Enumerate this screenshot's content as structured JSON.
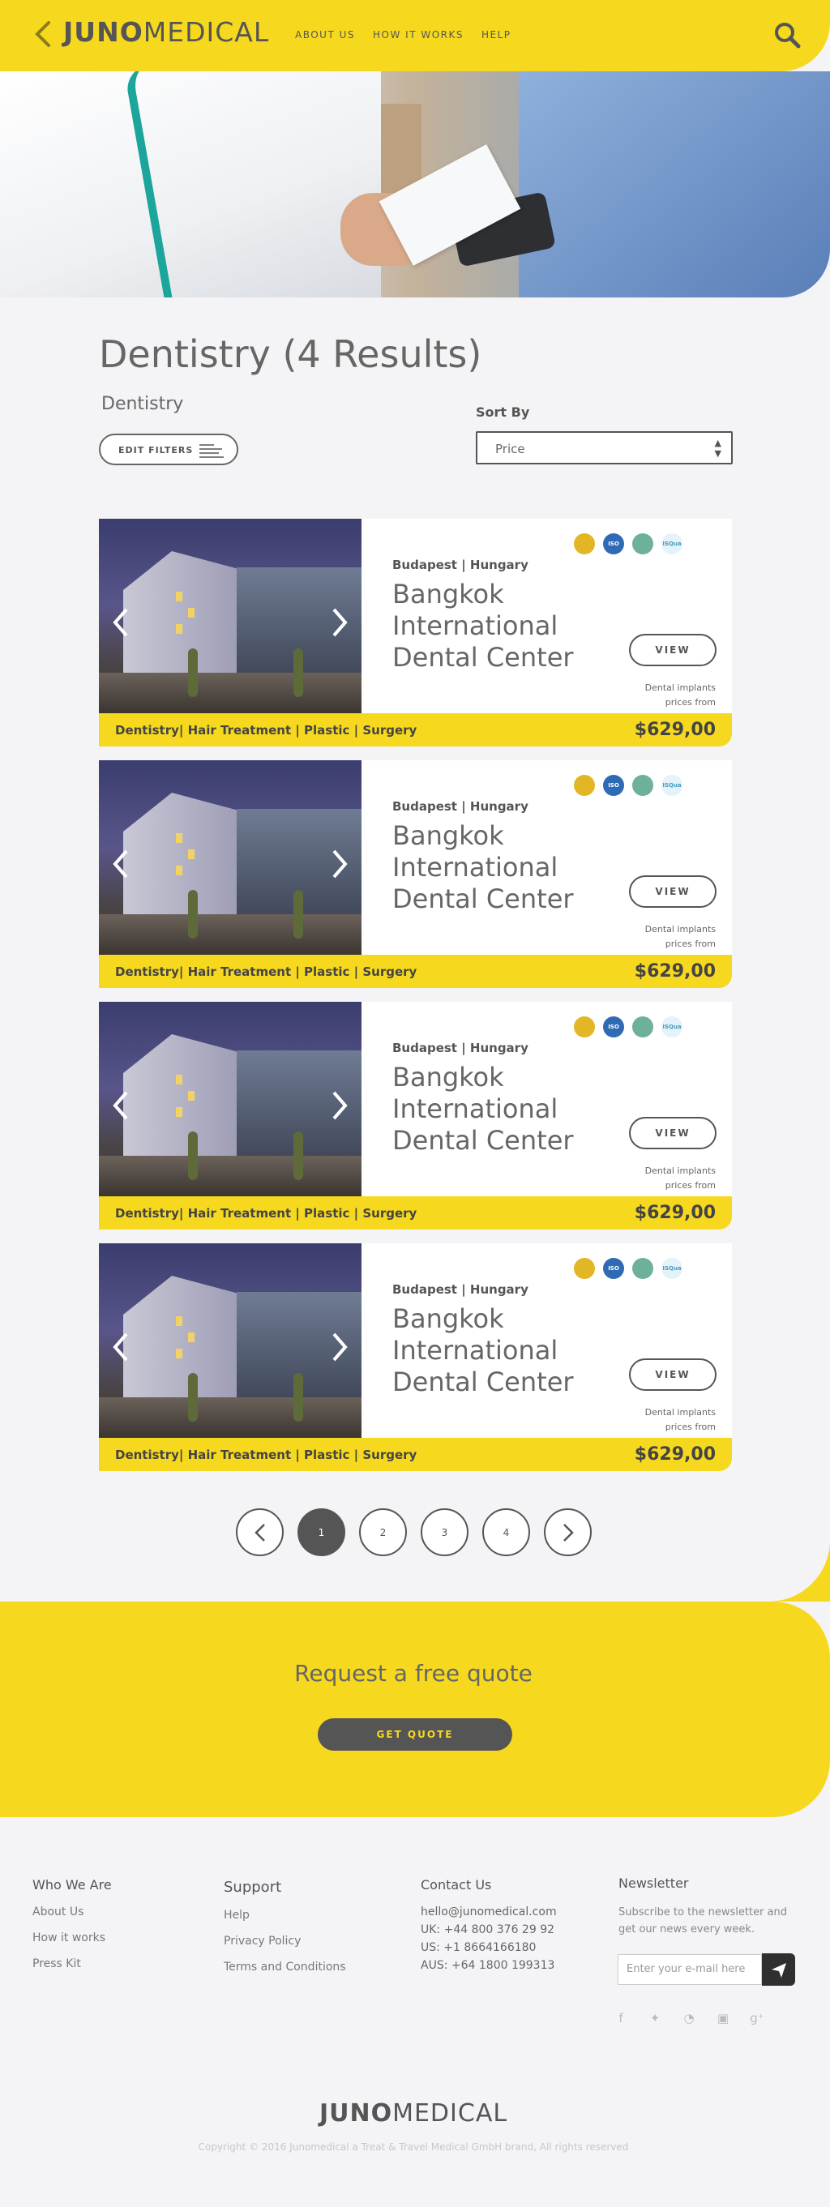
{
  "header": {
    "logo_bold": "JUNO",
    "logo_rest": "MEDICAL",
    "nav": [
      "ABOUT US",
      "HOW IT WORKS",
      "HELP"
    ]
  },
  "colors": {
    "accent": "#f6d91e",
    "dark": "#555555"
  },
  "page": {
    "title": "Dentistry (4 Results)",
    "subcategory": "Dentistry",
    "edit_filters": "EDIT FILTERS",
    "sort_label": "Sort By",
    "sort_value": "Price"
  },
  "cards": [
    {
      "location": "Budapest | Hungary",
      "name": "Bangkok International Dental Center",
      "view": "VIEW",
      "note": "Dental implants prices from",
      "categories": "Dentistry| Hair Treatment | Plastic | Surgery",
      "price": "$629,00",
      "badges": [
        "gold-seal",
        "ISO",
        "green-seal",
        "ISQua"
      ]
    },
    {
      "location": "Budapest | Hungary",
      "name": "Bangkok International Dental Center",
      "view": "VIEW",
      "note": "Dental implants prices from",
      "categories": "Dentistry| Hair Treatment | Plastic | Surgery",
      "price": "$629,00",
      "badges": [
        "gold-seal",
        "ISO",
        "green-seal",
        "ISQua"
      ]
    },
    {
      "location": "Budapest | Hungary",
      "name": "Bangkok International Dental Center",
      "view": "VIEW",
      "note": "Dental implants prices from",
      "categories": "Dentistry| Hair Treatment | Plastic | Surgery",
      "price": "$629,00",
      "badges": [
        "gold-seal",
        "ISO",
        "green-seal",
        "ISQua"
      ]
    },
    {
      "location": "Budapest | Hungary",
      "name": "Bangkok International Dental Center",
      "view": "VIEW",
      "note": "Dental implants prices from",
      "categories": "Dentistry| Hair Treatment | Plastic | Surgery",
      "price": "$629,00",
      "badges": [
        "gold-seal",
        "ISO",
        "green-seal",
        "ISQua"
      ]
    }
  ],
  "pagination": {
    "pages": [
      "1",
      "2",
      "3",
      "4"
    ],
    "current": "1"
  },
  "quote": {
    "title": "Request a free quote",
    "button": "GET QUOTE"
  },
  "footer": {
    "who": {
      "title": "Who We Are",
      "links": [
        "About Us",
        "How it works",
        "Press Kit"
      ]
    },
    "support": {
      "title": "Support",
      "links": [
        "Help",
        "Privacy Policy",
        "Terms and Conditions"
      ]
    },
    "contact": {
      "title": "Contact Us",
      "lines": [
        "hello@junomedical.com",
        "UK: +44 800 376 29 92",
        "US: +1 8664166180",
        "AUS: +64 1800 199313"
      ]
    },
    "newsletter": {
      "title": "Newsletter",
      "text": "Subscribe to the newsletter and get our news every week.",
      "placeholder": "Enter your e-mail here"
    },
    "socials": [
      "facebook-icon",
      "twitter-icon",
      "rss-icon",
      "instagram-icon",
      "google-plus-icon"
    ],
    "logo_bold": "JUNO",
    "logo_rest": "MEDICAL",
    "copyright": "Copyright © 2016 Junomedical a Treat & Travel Medical GmbH brand, All rights reserved"
  }
}
